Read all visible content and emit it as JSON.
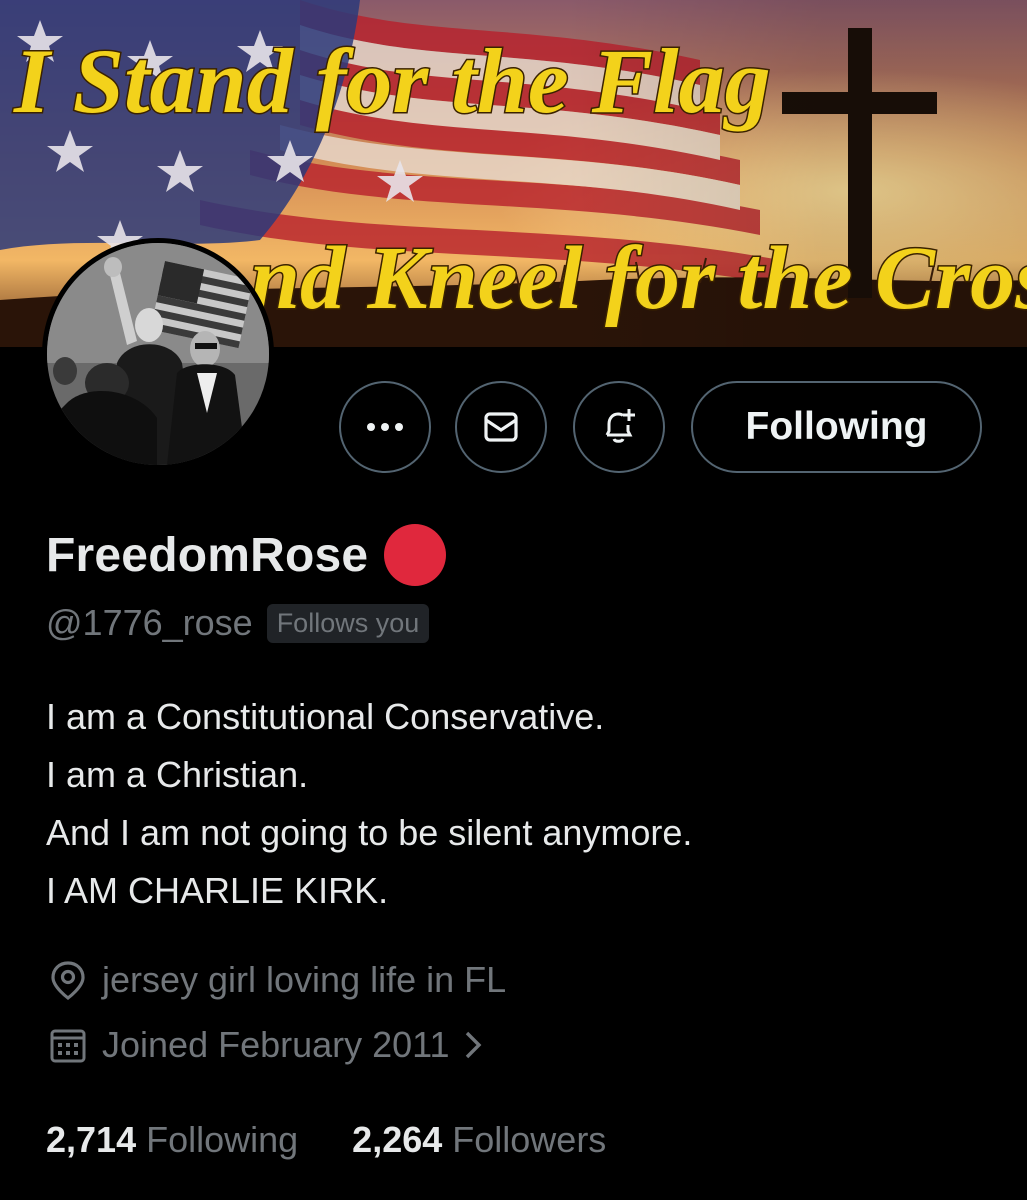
{
  "banner": {
    "line1": "I Stand for the Flag",
    "line2": "nd Kneel for the Cross"
  },
  "profile": {
    "display_name": "FreedomRose",
    "handle": "@1776_rose",
    "follows_you_badge": "Follows you",
    "bio_lines": [
      "I am a Constitutional Conservative.",
      "I am a Christian.",
      "And I am not going to be silent anymore.",
      "I AM CHARLIE KIRK."
    ],
    "location": "jersey girl loving life in FL",
    "joined": "Joined February 2011"
  },
  "actions": {
    "more_icon": "more-icon",
    "message_icon": "envelope-icon",
    "notify_icon": "bell-plus-icon",
    "follow_label": "Following"
  },
  "stats": {
    "following_count": "2,714",
    "following_label": "Following",
    "followers_count": "2,264",
    "followers_label": "Followers"
  },
  "colors": {
    "background": "#000000",
    "primary_text": "#e7e9ea",
    "secondary_text": "#71767b",
    "button_border": "#536471",
    "status_dot": "#e0283d",
    "banner_text": "#f3d21b"
  }
}
